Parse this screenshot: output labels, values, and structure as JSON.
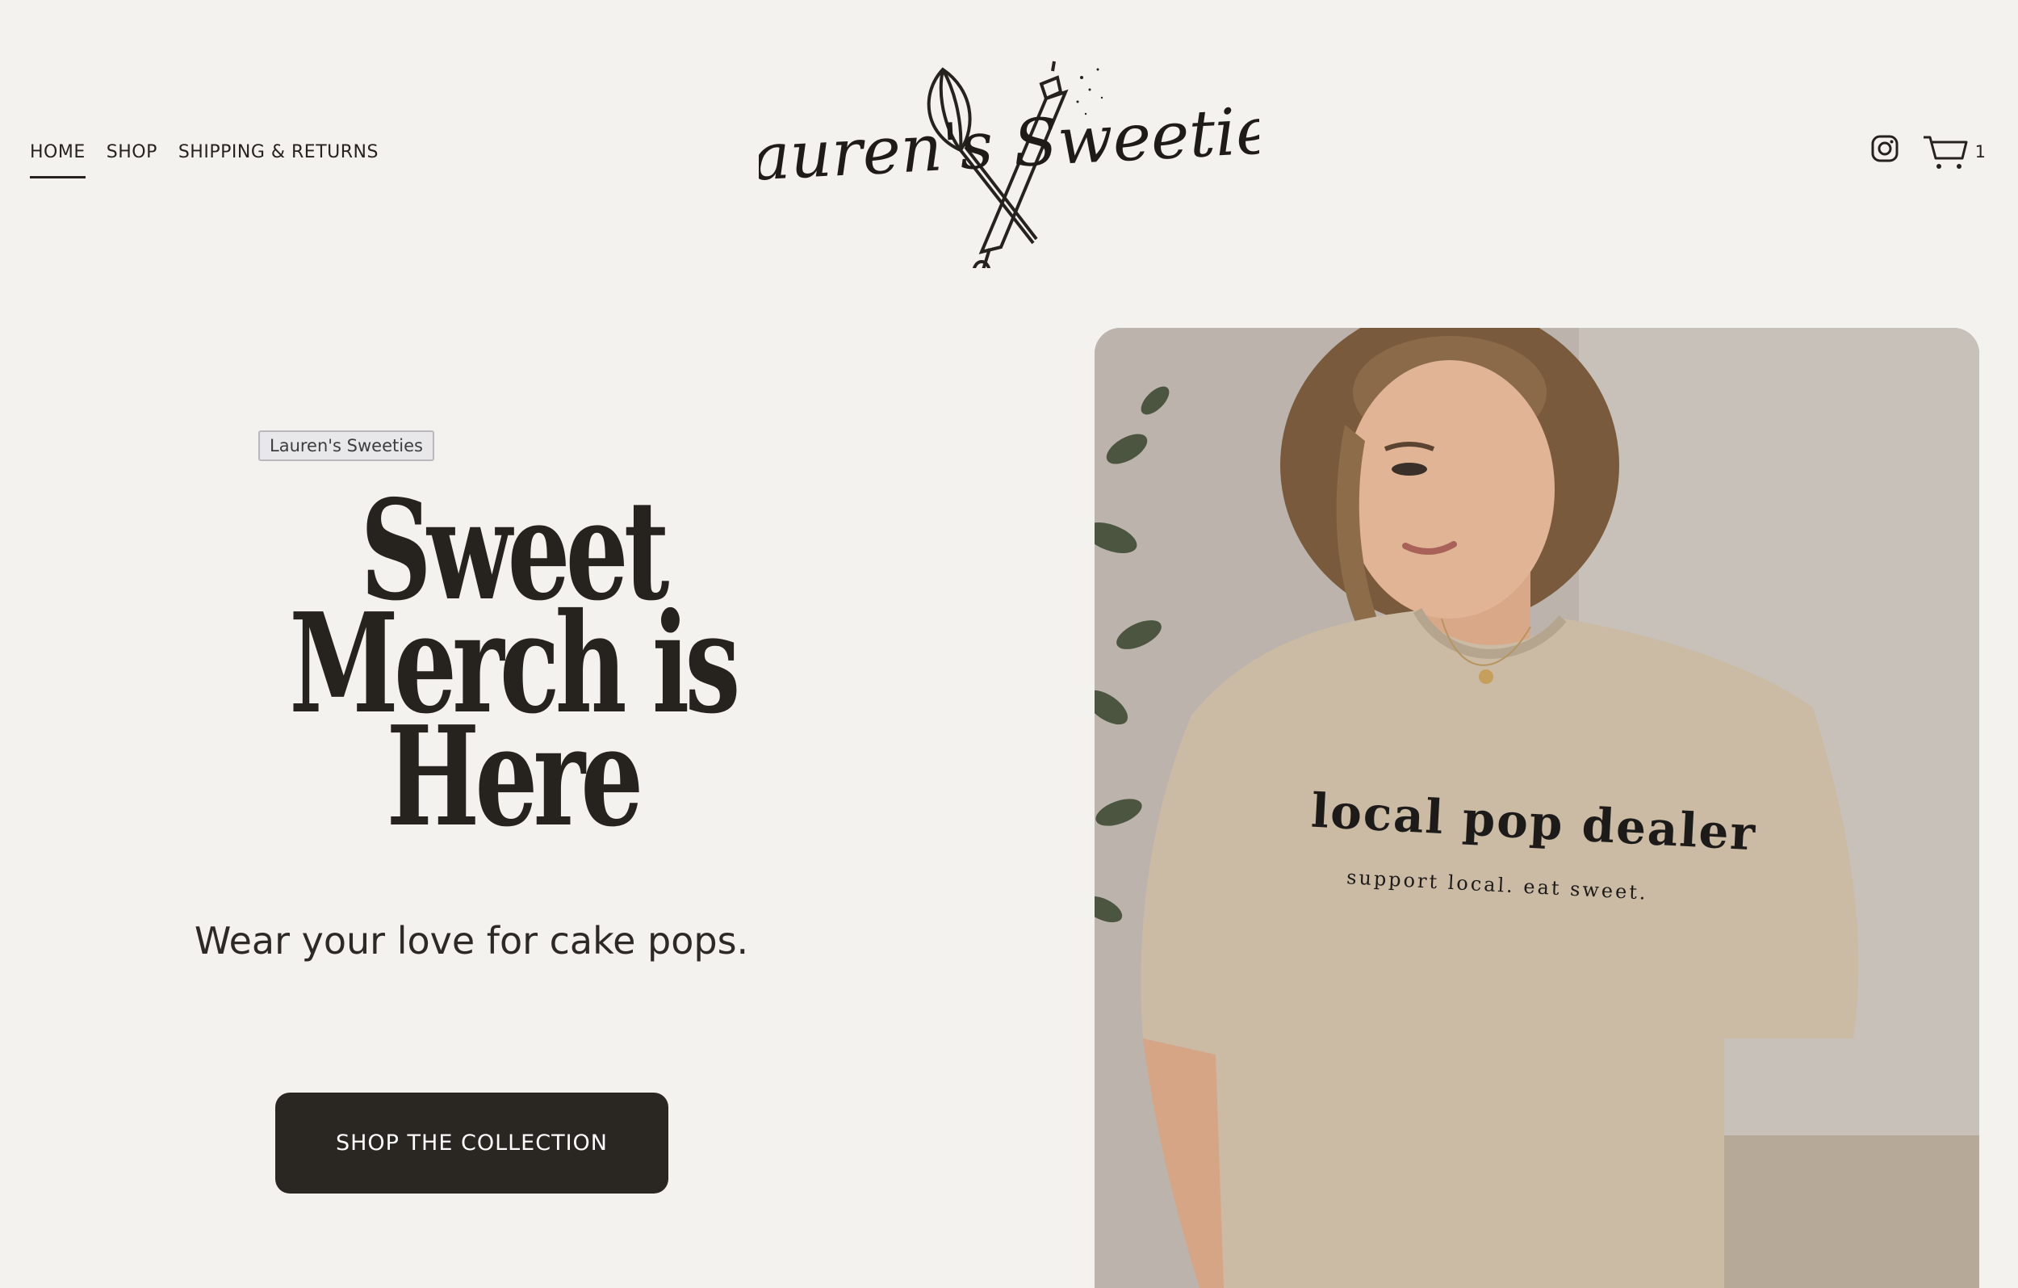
{
  "header": {
    "nav": [
      {
        "label": "HOME",
        "active": true
      },
      {
        "label": "SHOP",
        "active": false
      },
      {
        "label": "SHIPPING & RETURNS",
        "active": false
      }
    ],
    "logo_text": "Lauren's Sweeties",
    "cart_count": "1",
    "icons": [
      "instagram-icon",
      "cart-icon"
    ]
  },
  "hero": {
    "tag": "Lauren's Sweeties",
    "headline": "Sweet Merch is Here",
    "subline": "Wear your love for cake pops.",
    "cta_label": "SHOP THE COLLECTION",
    "image": {
      "shirt_text_main": "local pop dealer",
      "shirt_text_sub": "support local. eat sweet."
    }
  },
  "colors": {
    "background": "#f4f2ee",
    "text": "#26231f",
    "button": "#2a2622",
    "button_text": "#ffffff"
  }
}
